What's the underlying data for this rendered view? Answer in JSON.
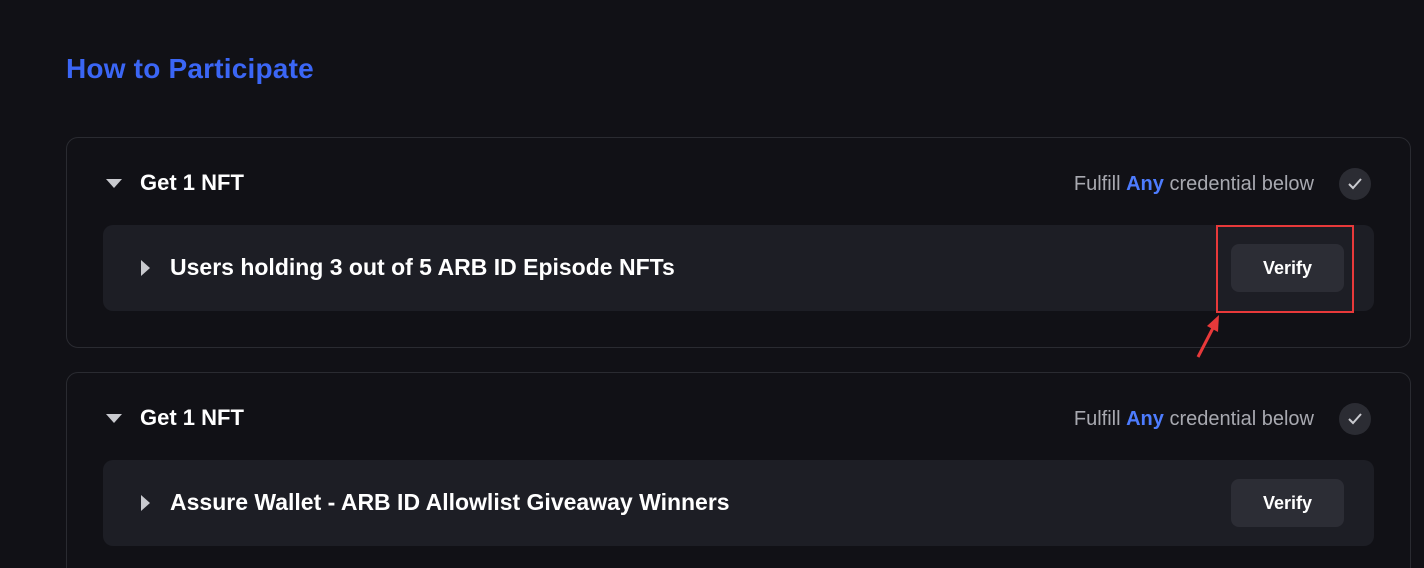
{
  "section": {
    "title": "How to Participate"
  },
  "cards": [
    {
      "title": "Get 1 NFT",
      "fulfill_prefix": "Fulfill ",
      "fulfill_any": "Any",
      "fulfill_suffix": " credential below",
      "credential": {
        "title": "Users holding 3 out of 5 ARB ID Episode NFTs",
        "button_label": "Verify"
      }
    },
    {
      "title": "Get 1 NFT",
      "fulfill_prefix": "Fulfill ",
      "fulfill_any": "Any",
      "fulfill_suffix": " credential below",
      "credential": {
        "title": "Assure Wallet - ARB ID Allowlist Giveaway Winners",
        "button_label": "Verify"
      }
    }
  ],
  "colors": {
    "background": "#111116",
    "accent": "#3b66f5",
    "any_highlight": "#4d7cfe",
    "annotation": "#e8393a"
  },
  "icons": [
    "caret-down-icon",
    "caret-right-icon",
    "check-icon",
    "annotation-arrow"
  ]
}
